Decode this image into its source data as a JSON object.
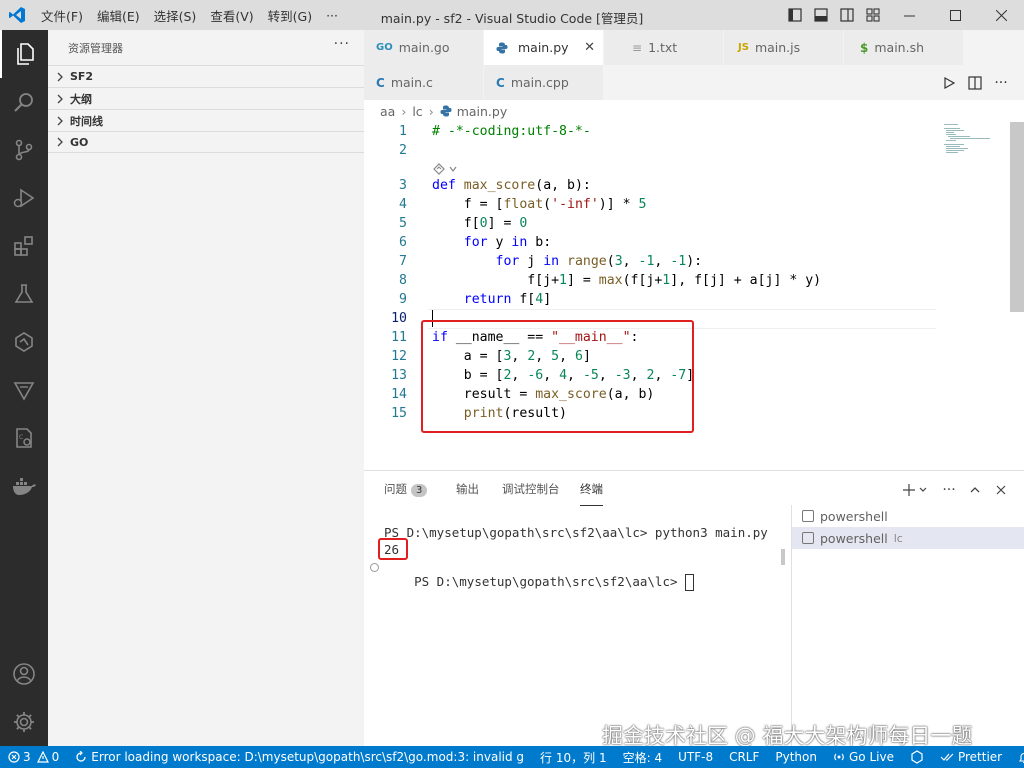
{
  "titlebar": {
    "menu": [
      "文件(F)",
      "编辑(E)",
      "选择(S)",
      "查看(V)",
      "转到(G)",
      "···"
    ],
    "title": "main.py - sf2 - Visual Studio Code [管理员]"
  },
  "sidebar": {
    "title": "资源管理器",
    "more": "···",
    "sections": [
      "SF2",
      "大纲",
      "时间线",
      "GO"
    ]
  },
  "tabs": {
    "row1": [
      {
        "icon": "GO",
        "label": "main.go"
      },
      {
        "icon": "PY",
        "label": "main.py",
        "close": "✕"
      },
      {
        "icon": "≡",
        "label": "1.txt"
      },
      {
        "icon": "JS",
        "label": "main.js"
      },
      {
        "icon": "$",
        "label": "main.sh"
      }
    ],
    "row2": [
      {
        "icon": "C",
        "label": "main.c"
      },
      {
        "icon": "C",
        "label": "main.cpp"
      }
    ]
  },
  "breadcrumb": [
    "aa",
    "lc",
    "main.py"
  ],
  "editor": {
    "lines": [
      {
        "n": "1",
        "t": "# -*-coding:utf-8-*-"
      },
      {
        "n": "2",
        "t": ""
      },
      {
        "n": "3",
        "t": "def max_score(a, b):"
      },
      {
        "n": "4",
        "t": "    f = [float('-inf')] * 5"
      },
      {
        "n": "5",
        "t": "    f[0] = 0"
      },
      {
        "n": "6",
        "t": "    for y in b:"
      },
      {
        "n": "7",
        "t": "        for j in range(3, -1, -1):"
      },
      {
        "n": "8",
        "t": "            f[j+1] = max(f[j+1], f[j] + a[j] * y)"
      },
      {
        "n": "9",
        "t": "    return f[4]"
      },
      {
        "n": "10",
        "t": ""
      },
      {
        "n": "11",
        "t": "if __name__ == \"__main__\":"
      },
      {
        "n": "12",
        "t": "    a = [3, 2, 5, 6]"
      },
      {
        "n": "13",
        "t": "    b = [2, -6, 4, -5, -3, 2, -7]"
      },
      {
        "n": "14",
        "t": "    result = max_score(a, b)"
      },
      {
        "n": "15",
        "t": "    print(result)"
      }
    ]
  },
  "panel": {
    "tabs": [
      "问题",
      "输出",
      "调试控制台",
      "终端"
    ],
    "problems_count": "3",
    "terminal": {
      "line1": "PS D:\\mysetup\\gopath\\src\\sf2\\aa\\lc> python3 main.py",
      "output": "26",
      "line3": "PS D:\\mysetup\\gopath\\src\\sf2\\aa\\lc> "
    },
    "terminals": [
      {
        "label": "powershell",
        "sub": ""
      },
      {
        "label": "powershell",
        "sub": "lc"
      }
    ]
  },
  "watermark": "掘金技术社区 @ 福大大架构师每日一题",
  "statusbar": {
    "errors": "3",
    "warnings": "0",
    "message": "Error loading workspace: D:\\mysetup\\gopath\\src\\sf2\\go.mod:3: invalid g",
    "position": "行 10，列 1",
    "spaces": "空格: 4",
    "encoding": "UTF-8",
    "eol": "CRLF",
    "language": "Python",
    "golive": "Go Live",
    "prettier": "Prettier"
  },
  "colors": {
    "accent": "#007acc",
    "highlight_box": "#e02020",
    "activity_bar": "#2c2c2c"
  }
}
